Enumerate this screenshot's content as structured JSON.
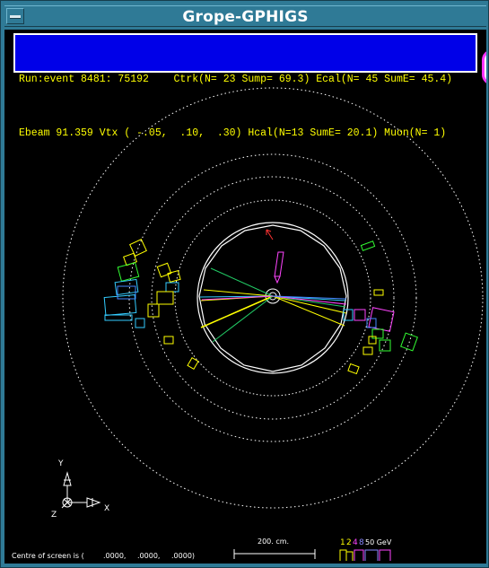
{
  "window": {
    "title": "Grope-GPHIGS"
  },
  "info": {
    "line1": "Run:event 8481: 75192    Ctrk(N= 23 Sump= 69.3) Ecal(N= 45 SumE= 45.4)",
    "line2": "Ebeam 91.359 Vtx ( -.05,  .10,  .30) Hcal(N=13 SumE= 20.1) Muon(N= 1)"
  },
  "axes": {
    "y": "Y",
    "x": "X",
    "z": "Z"
  },
  "status": {
    "centre_label": "Centre of screen is (",
    "centre_x": ".0000,",
    "centre_y": ".0000,",
    "centre_z": ".0000)",
    "scale_label": "200. cm.",
    "energy_label": "50 GeV"
  },
  "energy_digits": [
    {
      "text": "1",
      "color": "#ffff00"
    },
    {
      "text": "2",
      "color": "#ffff00"
    },
    {
      "text": "4",
      "color": "#ff44ff"
    },
    {
      "text": "8",
      "color": "#8888ff"
    }
  ],
  "colors": {
    "background": "#000000",
    "detector": "#ffffff",
    "track_yellow": "#ffff00",
    "track_green": "#22cc66",
    "track_cyan": "#33ccff",
    "track_magenta": "#ff44ff",
    "track_blue": "#4488ff",
    "track_red": "#ff3333",
    "hcal_green": "#33ff33",
    "info_bg": "#0000e8"
  }
}
